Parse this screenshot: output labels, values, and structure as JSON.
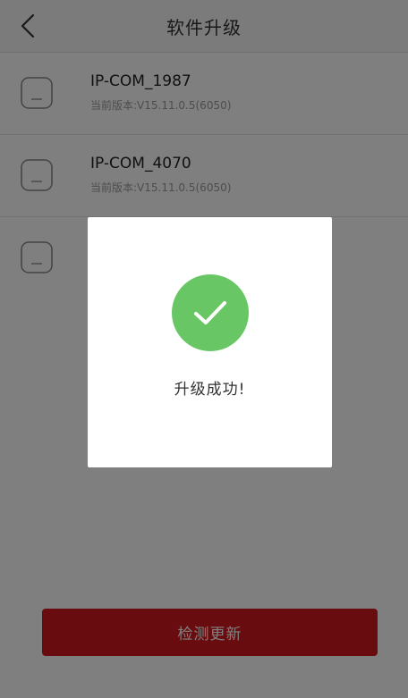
{
  "header": {
    "title": "软件升级"
  },
  "devices": [
    {
      "name": "IP-COM_1987",
      "version": "当前版本:V15.11.0.5(6050)"
    },
    {
      "name": "IP-COM_4070",
      "version": "当前版本:V15.11.0.5(6050)"
    },
    {
      "name": "",
      "version": ""
    }
  ],
  "check_button": {
    "label": "检测更新"
  },
  "dialog": {
    "message": "升级成功!"
  },
  "colors": {
    "accent": "#d3181f",
    "success": "#68c764",
    "overlay": "rgba(0,0,0,0.5)"
  }
}
